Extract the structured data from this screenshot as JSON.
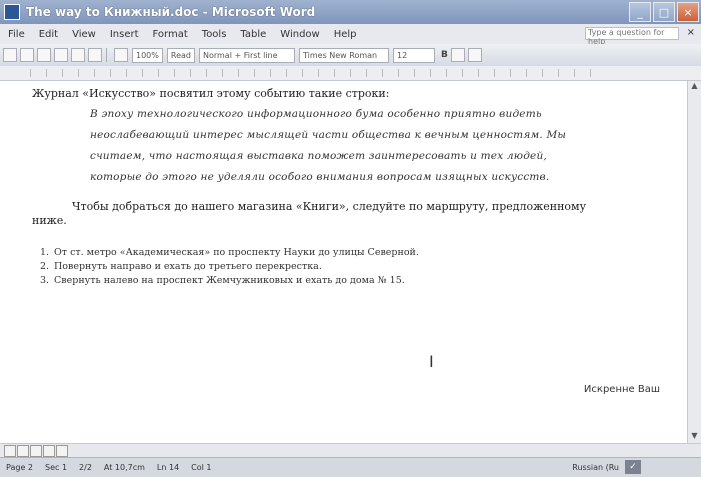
{
  "window": {
    "title": "The way to Книжный.doc - Microsoft Word",
    "buttons": {
      "minimize": "_",
      "maximize": "□",
      "close": "×"
    }
  },
  "menu": {
    "items": [
      "File",
      "Edit",
      "View",
      "Insert",
      "Format",
      "Tools",
      "Table",
      "Window",
      "Help"
    ],
    "help_placeholder": "Type a question for help",
    "close_label": "×"
  },
  "toolbar": {
    "zoom": "100%",
    "read_label": "Read",
    "style": "Normal + First line",
    "font": "Times New Roman",
    "font_size": "12",
    "bold": "B"
  },
  "document": {
    "intro": "Журнал «Искусство» посвятил этому событию такие строки:",
    "quote": "В эпоху технологического информационного бума особенно приятно видеть неослабевающий интерес мыслящей части общества к вечным ценностям. Мы считаем, что настоящая выставка поможет заинтересовать и тех людей, которые до этого не уделяли особого внимания вопросам изящных искусств.",
    "route_text": "Чтобы добраться до нашего магазина «Книги», следуйте по маршруту, предложенному ниже.",
    "steps": [
      {
        "num": "1.",
        "text": "От ст. метро «Академическая» по проспекту Науки до улицы Северной."
      },
      {
        "num": "2.",
        "text": "Повернуть направо и ехать до третьего перекрестка."
      },
      {
        "num": "3.",
        "text": "Свернуть налево на проспект Жемчужниковых и ехать до дома № 15."
      }
    ],
    "cursor": "I",
    "signature": "Искренне Ваш"
  },
  "status": {
    "page": "Page 2",
    "sec": "Sec 1",
    "pages": "2/2",
    "at": "At 10,7cm",
    "ln": "Ln 14",
    "col": "Col 1",
    "language": "Russian (Ru",
    "spell_icon": "book-check-icon"
  }
}
